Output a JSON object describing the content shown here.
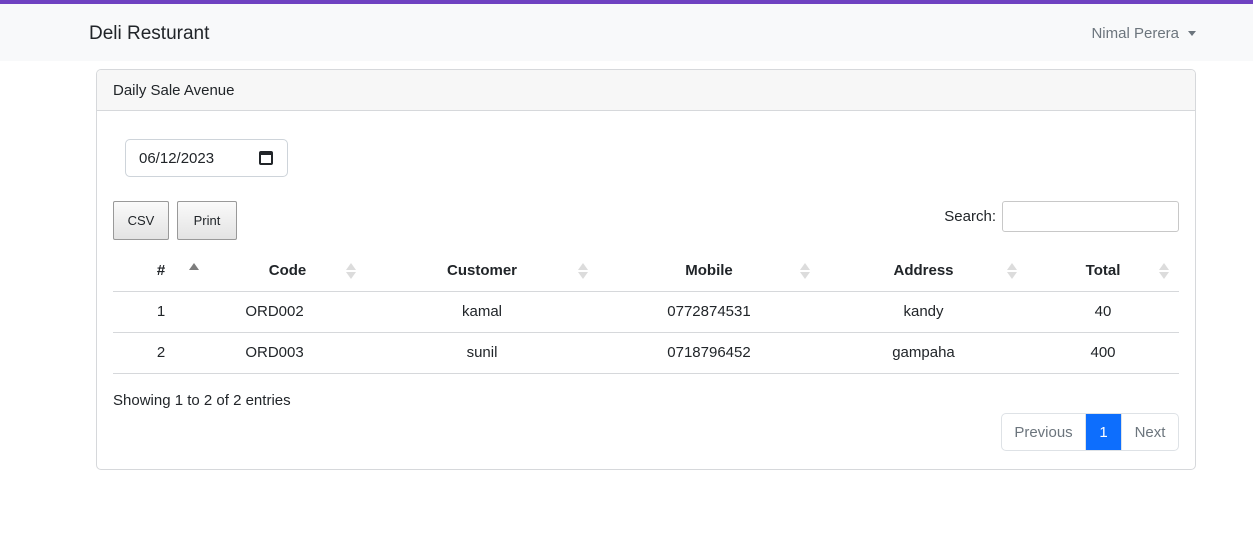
{
  "navbar": {
    "brand": "Deli Resturant",
    "user": "Nimal Perera",
    "accent_color": "#6f42c1"
  },
  "card": {
    "title": "Daily Sale Avenue",
    "date_value": "06/12/2023",
    "buttons": {
      "csv": "CSV",
      "print": "Print"
    },
    "search_label": "Search:",
    "table": {
      "columns": [
        "#",
        "Code",
        "Customer",
        "Mobile",
        "Address",
        "Total"
      ],
      "rows": [
        [
          "1",
          "ORD002",
          "kamal",
          "0772874531",
          "kandy",
          "40"
        ],
        [
          "2",
          "ORD003",
          "sunil",
          "0718796452",
          "gampaha",
          "400"
        ]
      ]
    },
    "info": "Showing 1 to 2 of 2 entries",
    "pagination": {
      "previous": "Previous",
      "current": "1",
      "next": "Next",
      "active_color": "#0d6efd"
    }
  },
  "icons": [
    "calendar-icon",
    "caret-down-icon",
    "sort-icon"
  ]
}
